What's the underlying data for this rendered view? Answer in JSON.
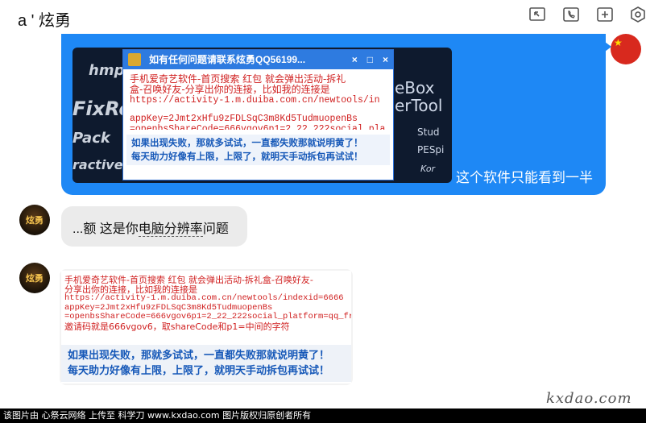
{
  "header": {
    "contact_name": "a ' 炫勇",
    "icons": [
      "screen-share-icon",
      "phone-icon",
      "add-contact-icon",
      "settings-icon"
    ]
  },
  "messages": {
    "m1": {
      "caption": "这个软件只能看到一半",
      "screenshot": {
        "window_title": "如有任何问题请联系炫勇QQ56199...",
        "window_controls": [
          "×",
          "□",
          "×"
        ],
        "line1": "手机爱奇艺软件-首页搜索 红包  就会弹出活动-拆礼",
        "line2": "盒-召唤好友-分享出你的连接，比如我的连接是",
        "line3": "https://activity-1.m.duiba.com.cn/newtools/in",
        "line4": "appKey=2Jmt2xHfu9zFDLSqC3m8Kd5TudmuopenBs",
        "line5": "=openbsShareCode=666vgov6p1=2_22_222social_pla",
        "highlight1": "如果出现失败，那就多试试，一直都失败那就说明黄了！",
        "highlight2": "每天助力好像有上限，上限了，就明天手动拆包再试试！",
        "bg_left": [
          "hmp",
          "FixRe",
          "Pack",
          "ractive"
        ],
        "bg_right": [
          "eBox",
          "erTool",
          "Stud",
          "PESpi",
          "Kor"
        ]
      }
    },
    "m2": {
      "avatar_text": "炫勇",
      "prefix": "...额 这是你",
      "underlined": "电脑分辨率",
      "suffix": "问题"
    },
    "m3": {
      "avatar_text": "炫勇",
      "line1": "手机爱奇艺软件-首页搜索 红包  就会弹出活动-拆礼盒-召唤好友-",
      "line2": "分享出你的连接，比如我的连接是",
      "line3": "https://activity-1.m.duiba.com.cn/newtools/indexid=6666",
      "line4": "appKey=2Jmt2xHfu9zFDLSqC3m8Kd5TudmuopenBs",
      "line5": "=openbsShareCode=666vgov6p1=2_22_222social_platform=qq_frien",
      "line6": "邀请码就是666vgov6，取shareCode和p1=中间的字符",
      "highlight1": "如果出现失败，那就多试试，一直都失败那就说明黄了！",
      "highlight2": "每天助力好像有上限，上限了，就明天手动拆包再试试！"
    }
  },
  "footer": {
    "text": "该图片由 心祭云网络 上传至 科学刀 www.kxdao.com 图片版权归原创者所有",
    "watermark": "kxdao.com"
  },
  "colors": {
    "bubble_blue": "#1e88f5",
    "highlight_blue": "#1658b8",
    "code_red": "#d02020"
  }
}
